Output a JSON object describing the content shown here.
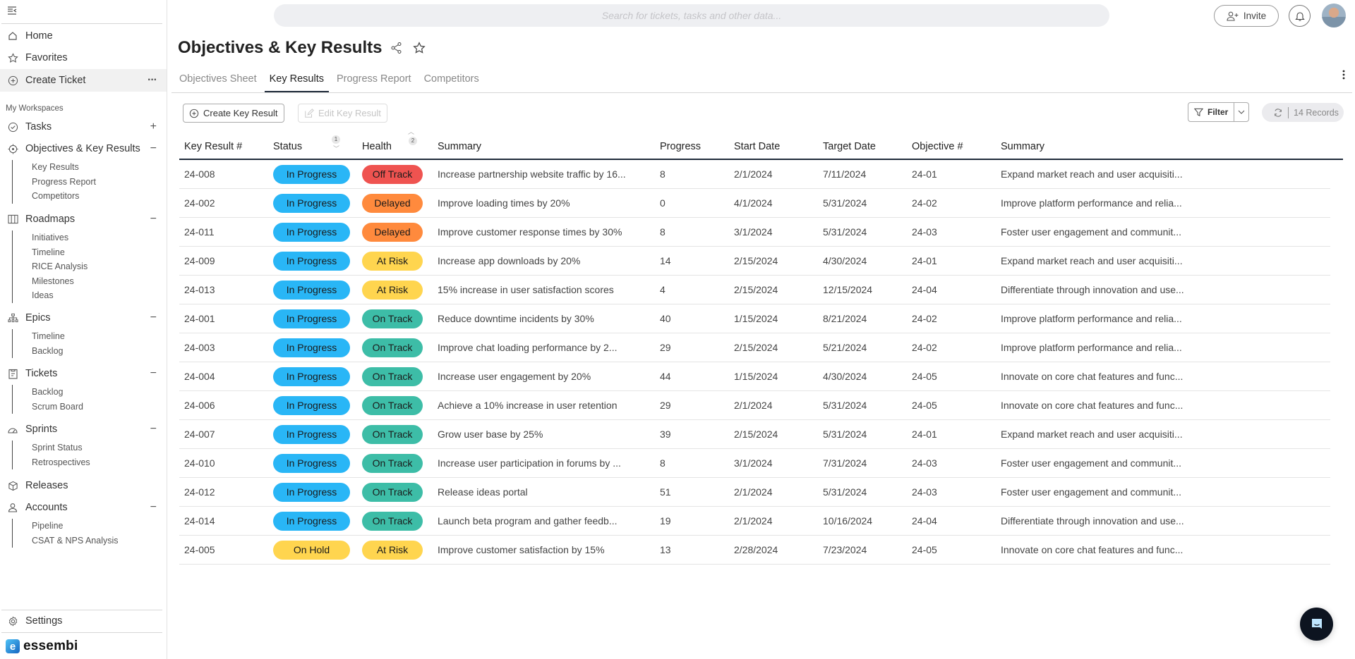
{
  "sidebar": {
    "nav": [
      {
        "label": "Home",
        "icon": "home-icon"
      },
      {
        "label": "Favorites",
        "icon": "star-icon"
      },
      {
        "label": "Create Ticket",
        "icon": "plus-circle-icon"
      }
    ],
    "workspaces_label": "My Workspaces",
    "tasks_label": "Tasks",
    "sections": [
      {
        "label": "Objectives & Key Results",
        "items": [
          "Key Results",
          "Progress Report",
          "Competitors"
        ]
      },
      {
        "label": "Roadmaps",
        "items": [
          "Initiatives",
          "Timeline",
          "RICE Analysis",
          "Milestones",
          "Ideas"
        ]
      },
      {
        "label": "Epics",
        "items": [
          "Timeline",
          "Backlog"
        ]
      },
      {
        "label": "Tickets",
        "items": [
          "Backlog",
          "Scrum Board"
        ]
      },
      {
        "label": "Sprints",
        "items": [
          "Sprint Status",
          "Retrospectives"
        ]
      },
      {
        "label": "Releases",
        "items": []
      },
      {
        "label": "Accounts",
        "items": [
          "Pipeline",
          "CSAT & NPS Analysis"
        ]
      }
    ],
    "settings_label": "Settings",
    "logo_text": "essembi"
  },
  "header": {
    "search_placeholder": "Search for tickets, tasks and other data...",
    "invite_label": "Invite"
  },
  "page": {
    "title": "Objectives & Key Results",
    "tabs": [
      "Objectives Sheet",
      "Key Results",
      "Progress Report",
      "Competitors"
    ],
    "active_tab": "Key Results"
  },
  "toolbar": {
    "create_label": "Create Key Result",
    "edit_label": "Edit Key Result",
    "filter_label": "Filter",
    "records_label": "14 Records"
  },
  "colors": {
    "in_progress": "#29b6f6",
    "on_hold": "#ffd54f",
    "off_track": "#ef5350",
    "delayed": "#ff8a3d",
    "at_risk": "#ffd54f",
    "on_track": "#3dbda7"
  },
  "table": {
    "columns": [
      "Key Result #",
      "Status",
      "Health",
      "Summary",
      "Progress",
      "Start Date",
      "Target Date",
      "Objective #",
      "Summary"
    ],
    "sort": {
      "status": "1",
      "health": "2"
    },
    "rows": [
      {
        "id": "24-008",
        "status": "In Progress",
        "health": "Off Track",
        "summary": "Increase partnership website traffic by 16...",
        "progress": "8",
        "start": "2/1/2024",
        "target": "7/11/2024",
        "objective": "24-01",
        "objective_summary": "Expand market reach and user acquisiti..."
      },
      {
        "id": "24-002",
        "status": "In Progress",
        "health": "Delayed",
        "summary": "Improve loading times by 20%",
        "progress": "0",
        "start": "4/1/2024",
        "target": "5/31/2024",
        "objective": "24-02",
        "objective_summary": "Improve platform performance and relia..."
      },
      {
        "id": "24-011",
        "status": "In Progress",
        "health": "Delayed",
        "summary": "Improve customer response times by 30%",
        "progress": "8",
        "start": "3/1/2024",
        "target": "5/31/2024",
        "objective": "24-03",
        "objective_summary": "Foster user engagement and communit..."
      },
      {
        "id": "24-009",
        "status": "In Progress",
        "health": "At Risk",
        "summary": "Increase app downloads by 20%",
        "progress": "14",
        "start": "2/15/2024",
        "target": "4/30/2024",
        "objective": "24-01",
        "objective_summary": "Expand market reach and user acquisiti..."
      },
      {
        "id": "24-013",
        "status": "In Progress",
        "health": "At Risk",
        "summary": "15% increase in user satisfaction scores",
        "progress": "4",
        "start": "2/15/2024",
        "target": "12/15/2024",
        "objective": "24-04",
        "objective_summary": "Differentiate through innovation and use..."
      },
      {
        "id": "24-001",
        "status": "In Progress",
        "health": "On Track",
        "summary": "Reduce downtime incidents by 30%",
        "progress": "40",
        "start": "1/15/2024",
        "target": "8/21/2024",
        "objective": "24-02",
        "objective_summary": "Improve platform performance and relia..."
      },
      {
        "id": "24-003",
        "status": "In Progress",
        "health": "On Track",
        "summary": "Improve chat loading performance by 2...",
        "progress": "29",
        "start": "2/15/2024",
        "target": "5/21/2024",
        "objective": "24-02",
        "objective_summary": "Improve platform performance and relia..."
      },
      {
        "id": "24-004",
        "status": "In Progress",
        "health": "On Track",
        "summary": "Increase user engagement by 20%",
        "progress": "44",
        "start": "1/15/2024",
        "target": "4/30/2024",
        "objective": "24-05",
        "objective_summary": "Innovate on core chat features and func..."
      },
      {
        "id": "24-006",
        "status": "In Progress",
        "health": "On Track",
        "summary": "Achieve a 10% increase in user retention",
        "progress": "29",
        "start": "2/1/2024",
        "target": "5/31/2024",
        "objective": "24-05",
        "objective_summary": "Innovate on core chat features and func..."
      },
      {
        "id": "24-007",
        "status": "In Progress",
        "health": "On Track",
        "summary": "Grow user base by 25%",
        "progress": "39",
        "start": "2/15/2024",
        "target": "5/31/2024",
        "objective": "24-01",
        "objective_summary": "Expand market reach and user acquisiti..."
      },
      {
        "id": "24-010",
        "status": "In Progress",
        "health": "On Track",
        "summary": "Increase user participation in forums by ...",
        "progress": "8",
        "start": "3/1/2024",
        "target": "7/31/2024",
        "objective": "24-03",
        "objective_summary": "Foster user engagement and communit..."
      },
      {
        "id": "24-012",
        "status": "In Progress",
        "health": "On Track",
        "summary": "Release ideas portal",
        "progress": "51",
        "start": "2/1/2024",
        "target": "5/31/2024",
        "objective": "24-03",
        "objective_summary": "Foster user engagement and communit..."
      },
      {
        "id": "24-014",
        "status": "In Progress",
        "health": "On Track",
        "summary": "Launch beta program and gather feedb...",
        "progress": "19",
        "start": "2/1/2024",
        "target": "10/16/2024",
        "objective": "24-04",
        "objective_summary": "Differentiate through innovation and use..."
      },
      {
        "id": "24-005",
        "status": "On Hold",
        "health": "At Risk",
        "summary": "Improve customer satisfaction by 15%",
        "progress": "13",
        "start": "2/28/2024",
        "target": "7/23/2024",
        "objective": "24-05",
        "objective_summary": "Innovate on core chat features and func..."
      }
    ]
  }
}
